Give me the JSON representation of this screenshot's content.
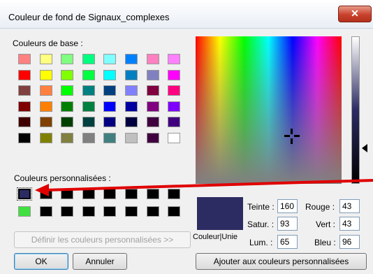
{
  "window": {
    "title": "Couleur de fond de Signaux_complexes",
    "close_glyph": "✕"
  },
  "basic_colors": {
    "label": "Couleurs de base :",
    "rows": [
      [
        "#ff8080",
        "#ffff80",
        "#80ff80",
        "#00ff80",
        "#80ffff",
        "#0080ff",
        "#ff80c0",
        "#ff80ff"
      ],
      [
        "#ff0000",
        "#ffff00",
        "#80ff00",
        "#00ff40",
        "#00ffff",
        "#0080c0",
        "#8080c0",
        "#ff00ff"
      ],
      [
        "#804040",
        "#ff8040",
        "#00ff00",
        "#008080",
        "#004080",
        "#8080ff",
        "#800040",
        "#ff0080"
      ],
      [
        "#800000",
        "#ff8000",
        "#008000",
        "#008040",
        "#0000ff",
        "#0000a0",
        "#800080",
        "#8000ff"
      ],
      [
        "#400000",
        "#804000",
        "#004000",
        "#004040",
        "#000080",
        "#000040",
        "#400040",
        "#400080"
      ],
      [
        "#000000",
        "#808000",
        "#808040",
        "#808080",
        "#408080",
        "#c0c0c0",
        "#400040",
        "#ffffff"
      ]
    ]
  },
  "custom_colors": {
    "label": "Couleurs personnalisées :",
    "rows": [
      [
        "#2c2b62",
        "#000000",
        "#000000",
        "#000000",
        "#000000",
        "#000000",
        "#000000",
        "#000000"
      ],
      [
        "#40e040",
        "#000000",
        "#000000",
        "#000000",
        "#000000",
        "#000000",
        "#000000",
        "#000000"
      ]
    ]
  },
  "buttons": {
    "define_custom": "Définir les couleurs personnalisées >>",
    "ok": "OK",
    "cancel": "Annuler",
    "add_custom": "Ajouter aux couleurs personnalisées"
  },
  "preview": {
    "label": "Couleur|Unie",
    "color": "#2c2b62"
  },
  "fields": {
    "hue": {
      "label": "Teinte :",
      "value": "160"
    },
    "sat": {
      "label": "Satur. :",
      "value": "93"
    },
    "lum": {
      "label": "Lum. :",
      "value": "65"
    },
    "red": {
      "label": "Rouge :",
      "value": "43"
    },
    "green": {
      "label": "Vert :",
      "value": "43"
    },
    "blue": {
      "label": "Bleu :",
      "value": "96"
    }
  },
  "annotation": {
    "arrow_color": "#e00000"
  }
}
